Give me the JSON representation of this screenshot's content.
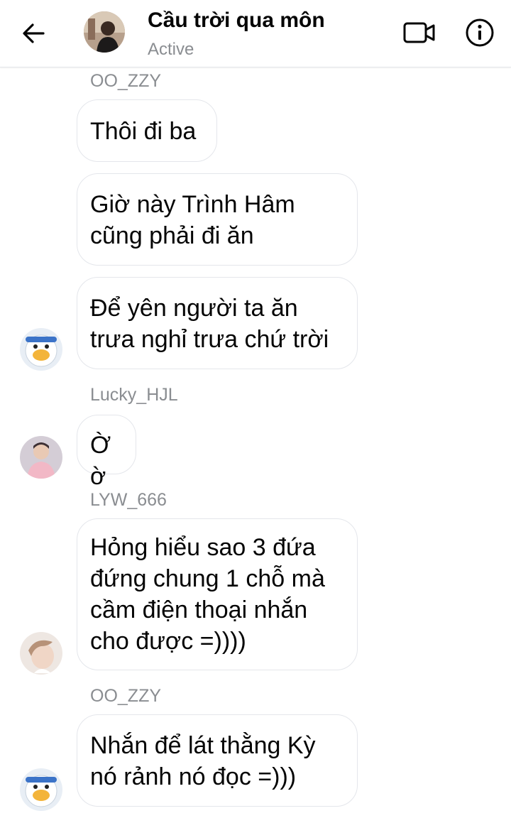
{
  "header": {
    "title": "Cầu trời qua môn",
    "status": "Active",
    "back_icon": "arrow-left-icon",
    "video_icon": "video-camera-icon",
    "info_icon": "info-icon"
  },
  "messages": [
    {
      "sender": "OO_ZZY",
      "text": "Thôi đi ba"
    },
    {
      "text": "Giờ này Trình Hâm\ncũng phải đi ăn"
    },
    {
      "text": "Để yên người ta ăn\ntrưa nghỉ trưa chứ trời"
    },
    {
      "sender": "Lucky_HJL",
      "text": "Ờ ờ"
    },
    {
      "sender": "LYW_666",
      "text": "Hỏng hiểu sao 3 đứa\nđứng chung 1 chỗ mà\ncầm điện thoại nhắn\ncho được =))))"
    },
    {
      "sender": "OO_ZZY",
      "text": "Nhắn để lát thằng Kỳ\nnó rảnh nó đọc =)))"
    }
  ],
  "colors": {
    "muted_text": "#8a8d91",
    "bubble_border": "#e4e6eb",
    "text": "#050505"
  }
}
